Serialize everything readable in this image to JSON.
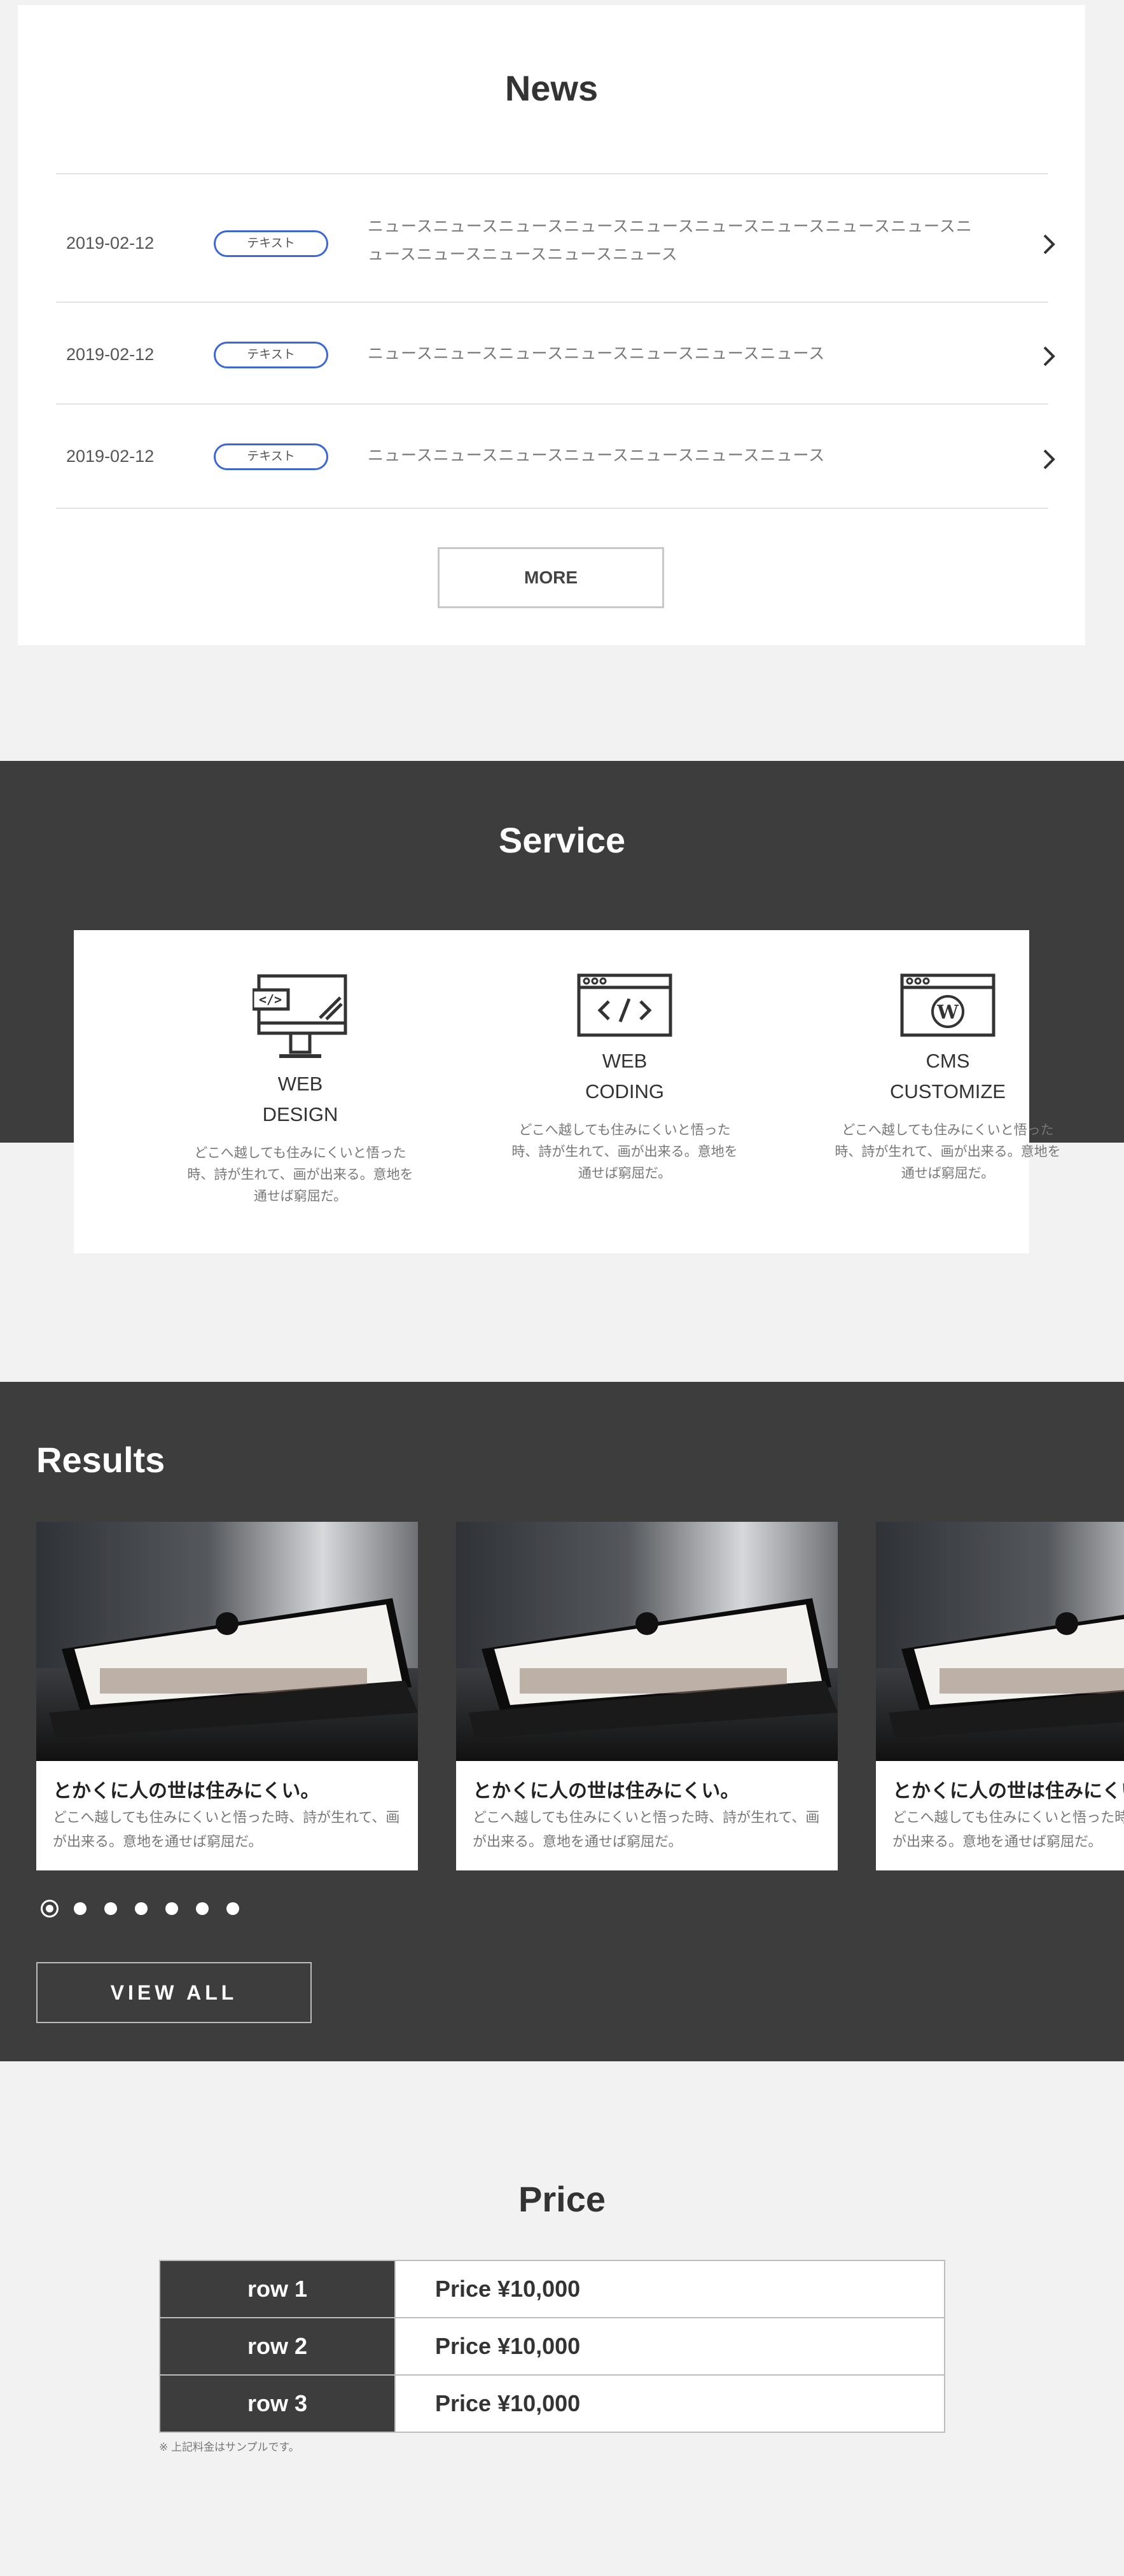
{
  "news": {
    "title": "News",
    "items": [
      {
        "date": "2019-02-12",
        "tag": "テキスト",
        "text": "ニュースニュースニュースニュースニュースニュースニュースニュースニュースニュースニュースニュースニュースニュース"
      },
      {
        "date": "2019-02-12",
        "tag": "テキスト",
        "text": "ニュースニュースニュースニュースニュースニュースニュース"
      },
      {
        "date": "2019-02-12",
        "tag": "テキスト",
        "text": "ニュースニュースニュースニュースニュースニュースニュース"
      }
    ],
    "more_label": "MORE",
    "tag_color": "#3b67d8"
  },
  "service": {
    "title": "Service",
    "items": [
      {
        "name_line1": "WEB",
        "name_line2": "DESIGN",
        "desc": "どこへ越しても住みにくいと悟った時、詩が生れて、画が出来る。意地を通せば窮屈だ。",
        "icon": "monitor-design-icon"
      },
      {
        "name_line1": "WEB",
        "name_line2": "CODING",
        "desc": "どこへ越しても住みにくいと悟った時、詩が生れて、画が出来る。意地を通せば窮屈だ。",
        "icon": "browser-code-icon"
      },
      {
        "name_line1": "CMS",
        "name_line2": "CUSTOMIZE",
        "desc": "どこへ越しても住みにくいと悟った時、詩が生れて、画が出来る。意地を通せば窮屈だ。",
        "icon": "wordpress-browser-icon"
      }
    ]
  },
  "results": {
    "title": "Results",
    "cards": [
      {
        "title": "とかくに人の世は住みにくい。",
        "desc": "どこへ越しても住みにくいと悟った時、詩が生れて、画が出来る。意地を通せば窮屈だ。"
      },
      {
        "title": "とかくに人の世は住みにくい。",
        "desc": "どこへ越しても住みにくいと悟った時、詩が生れて、画が出来る。意地を通せば窮屈だ。"
      },
      {
        "title": "とかくに人の世は住みにくい。",
        "desc": "どこへ越しても住みにくいと悟った時、詩が生れて、画が出来る。意地を通せば窮屈だ。"
      }
    ],
    "dots_count": 7,
    "active_dot": 1,
    "view_all_label": "VIEW ALL"
  },
  "price": {
    "title": "Price",
    "rows": [
      {
        "label": "row 1",
        "price": "Price ¥10,000"
      },
      {
        "label": "row 2",
        "price": "Price ¥10,000"
      },
      {
        "label": "row 3",
        "price": "Price ¥10,000"
      }
    ],
    "note": "※ 上記料金はサンプルです。"
  },
  "colors": {
    "dark_bg": "#3d3d3d",
    "page_bg": "#f2f2f2",
    "accent": "#3b67d8"
  }
}
